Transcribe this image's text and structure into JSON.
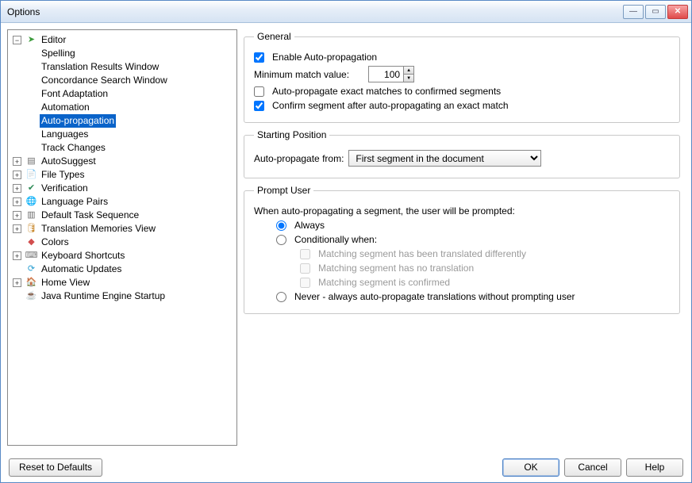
{
  "window": {
    "title": "Options"
  },
  "tree": {
    "editor": {
      "label": "Editor",
      "children": {
        "spelling": "Spelling",
        "translation_results": "Translation Results Window",
        "concordance": "Concordance Search Window",
        "font_adaptation": "Font Adaptation",
        "automation": "Automation",
        "auto_propagation": "Auto-propagation",
        "languages": "Languages",
        "track_changes": "Track Changes"
      }
    },
    "autosuggest": "AutoSuggest",
    "file_types": "File Types",
    "verification": "Verification",
    "language_pairs": "Language Pairs",
    "default_task_sequence": "Default Task Sequence",
    "tm_view": "Translation Memories View",
    "colors": "Colors",
    "keyboard_shortcuts": "Keyboard Shortcuts",
    "automatic_updates": "Automatic Updates",
    "home_view": "Home View",
    "java_startup": "Java Runtime Engine Startup"
  },
  "general": {
    "legend": "General",
    "enable_label": "Enable Auto-propagation",
    "enable_checked": true,
    "min_match_label": "Minimum match value:",
    "min_match_value": "100",
    "propagate_confirmed_label": "Auto-propagate exact matches to confirmed segments",
    "propagate_confirmed_checked": false,
    "confirm_after_label": "Confirm segment after auto-propagating an exact match",
    "confirm_after_checked": true
  },
  "starting": {
    "legend": "Starting Position",
    "from_label": "Auto-propagate from:",
    "from_value": "First segment in the document"
  },
  "prompt": {
    "legend": "Prompt User",
    "intro": "When auto-propagating a segment, the user will be prompted:",
    "always_label": "Always",
    "conditionally_label": "Conditionally when:",
    "cond_translated_diff": "Matching segment has been translated differently",
    "cond_no_translation": "Matching segment has no translation",
    "cond_confirmed": "Matching segment is confirmed",
    "never_label": "Never - always auto-propagate translations without prompting user",
    "selected": "always"
  },
  "footer": {
    "reset": "Reset to Defaults",
    "ok": "OK",
    "cancel": "Cancel",
    "help": "Help"
  }
}
